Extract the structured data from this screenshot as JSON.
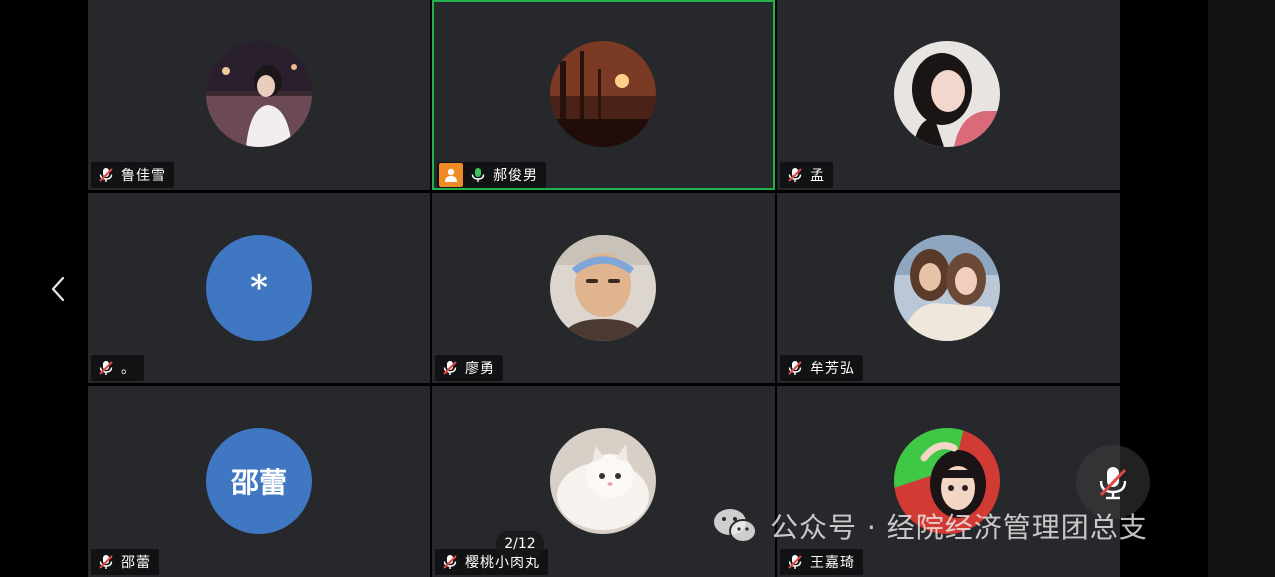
{
  "participants": [
    {
      "name": "鲁佳雪",
      "muted": true,
      "host": false,
      "avatar": "photo",
      "avatar_icon": "night-street-photo"
    },
    {
      "name": "郝俊男",
      "muted": false,
      "host": true,
      "speaking": true,
      "avatar": "photo",
      "avatar_icon": "sunset-photo"
    },
    {
      "name": "孟",
      "muted": true,
      "host": false,
      "avatar": "photo",
      "avatar_icon": "portrait-photo"
    },
    {
      "name": "。",
      "muted": true,
      "host": false,
      "avatar": "text",
      "avatar_text": "*"
    },
    {
      "name": "廖勇",
      "muted": true,
      "host": false,
      "avatar": "photo",
      "avatar_icon": "man-photo"
    },
    {
      "name": "牟芳弘",
      "muted": true,
      "host": false,
      "avatar": "photo",
      "avatar_icon": "two-women-photo"
    },
    {
      "name": "邵蕾",
      "muted": true,
      "host": false,
      "avatar": "text",
      "avatar_text": "邵蕾"
    },
    {
      "name": "樱桃小肉丸",
      "muted": true,
      "host": false,
      "avatar": "photo",
      "avatar_icon": "white-cat-photo"
    },
    {
      "name": "王嘉琦",
      "muted": true,
      "host": false,
      "avatar": "photo",
      "avatar_icon": "cartoon-girl-photo"
    }
  ],
  "page_indicator": "2/12",
  "watermark": "公众号 · 经院经济管理团总支",
  "colors": {
    "tile_bg": "#27282b",
    "active_border": "#26b04b",
    "text_avatar_bg": "#3f77c3",
    "host_badge": "#f08a24",
    "muted_red": "#e04848",
    "speaking_green": "#3ec55a"
  }
}
